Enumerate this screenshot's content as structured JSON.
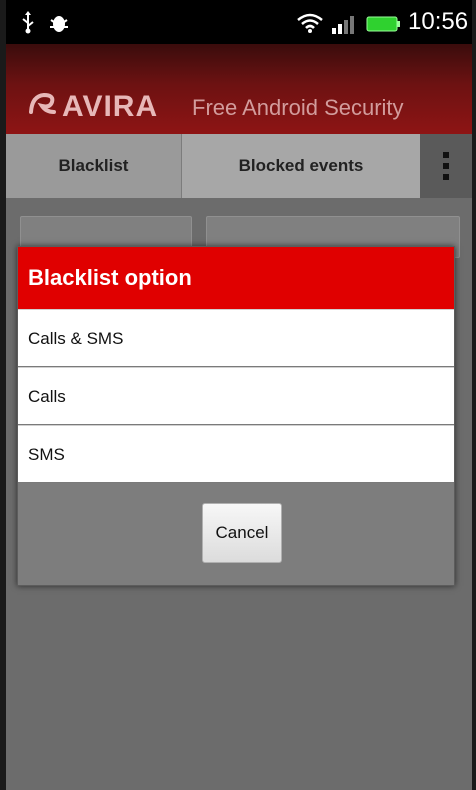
{
  "status_bar": {
    "time": "10:56"
  },
  "header": {
    "brand": "AVIRA",
    "tagline": "Free Android Security"
  },
  "tabs": [
    {
      "label": "Blacklist"
    },
    {
      "label": "Blocked events"
    }
  ],
  "dialog": {
    "title": "Blacklist option",
    "options": [
      {
        "label": "Calls & SMS"
      },
      {
        "label": "Calls"
      },
      {
        "label": "SMS"
      }
    ],
    "cancel_label": "Cancel"
  },
  "colors": {
    "brand_red": "#8e1414",
    "dialog_title_red": "#e00000"
  }
}
